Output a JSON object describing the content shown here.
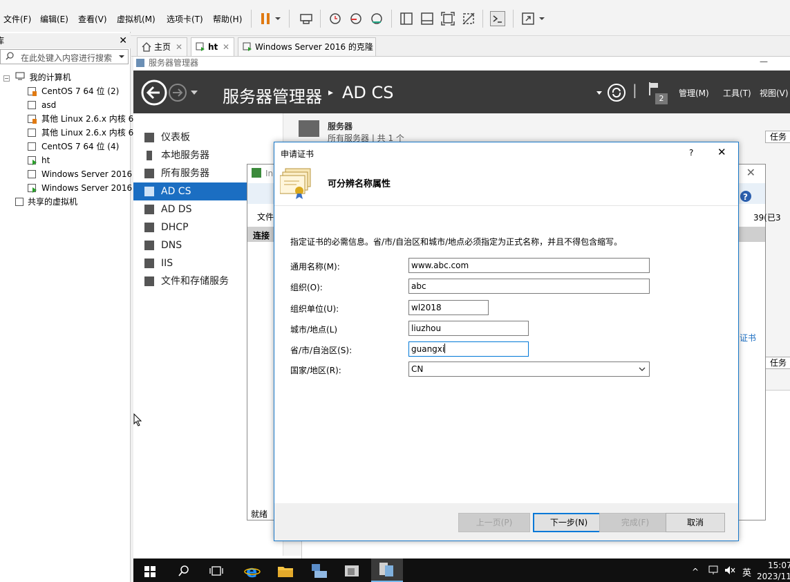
{
  "vmware": {
    "menu": [
      "文件(F)",
      "编辑(E)",
      "查看(V)",
      "虚拟机(M)",
      "选项卡(T)",
      "帮助(H)"
    ],
    "library": {
      "title": "库",
      "search_placeholder": "在此处键入内容进行搜索",
      "root": "我的计算机",
      "vms": [
        "CentOS 7 64 位 (2)",
        "asd",
        "其他 Linux 2.6.x 内核 6",
        "其他 Linux 2.6.x 内核 6",
        "CentOS 7 64 位 (4)",
        "ht",
        "Windows Server 2016",
        "Windows Server 2016"
      ],
      "shared": "共享的虚拟机"
    },
    "tabs": [
      {
        "label": "主页",
        "icon": "home-icon"
      },
      {
        "label": "ht",
        "icon": "vm-icon"
      },
      {
        "label": "Windows Server 2016 的克隆",
        "icon": "vm-icon"
      }
    ]
  },
  "server_manager": {
    "window_title": "服务器管理器",
    "breadcrumb_app": "服务器管理器",
    "breadcrumb_sep": "▸",
    "breadcrumb_page": "AD CS",
    "notif_count": "2",
    "menu": [
      "管理(M)",
      "工具(T)",
      "视图(V)"
    ],
    "nav": [
      "仪表板",
      "本地服务器",
      "所有服务器",
      "AD CS",
      "AD DS",
      "DHCP",
      "DNS",
      "IIS",
      "文件和存储服务"
    ],
    "selected_nav": "AD CS",
    "servers_title": "服务器",
    "servers_sub": "所有服务器 | 共 1 个",
    "tasks": "任务"
  },
  "background_window": {
    "title_fragment": "In",
    "menu_fragment": "文件",
    "connection": "连接",
    "status": "就绪",
    "right_fragment": "39(已3",
    "cert_fragment": "证书"
  },
  "dialog": {
    "title": "申请证书",
    "help": "?",
    "close": "✕",
    "heading": "可分辨名称属性",
    "instruction": "指定证书的必需信息。省/市/自治区和城市/地点必须指定为正式名称，并且不得包含缩写。",
    "fields": [
      {
        "label": "通用名称(M):",
        "value": "www.abc.com"
      },
      {
        "label": "组织(O):",
        "value": "abc"
      },
      {
        "label": "组织单位(U):",
        "value": "wl2018"
      },
      {
        "label": "城市/地点(L)",
        "value": "liuzhou"
      },
      {
        "label": "省/市/自治区(S):",
        "value": "guangxi"
      },
      {
        "label": "国家/地区(R):",
        "value": "CN"
      }
    ],
    "buttons": {
      "prev": "上一页(P)",
      "next": "下一步(N)",
      "finish": "完成(F)",
      "cancel": "取消"
    }
  },
  "taskbar": {
    "time": "15:07",
    "date": "2023/11",
    "ime": "英"
  }
}
